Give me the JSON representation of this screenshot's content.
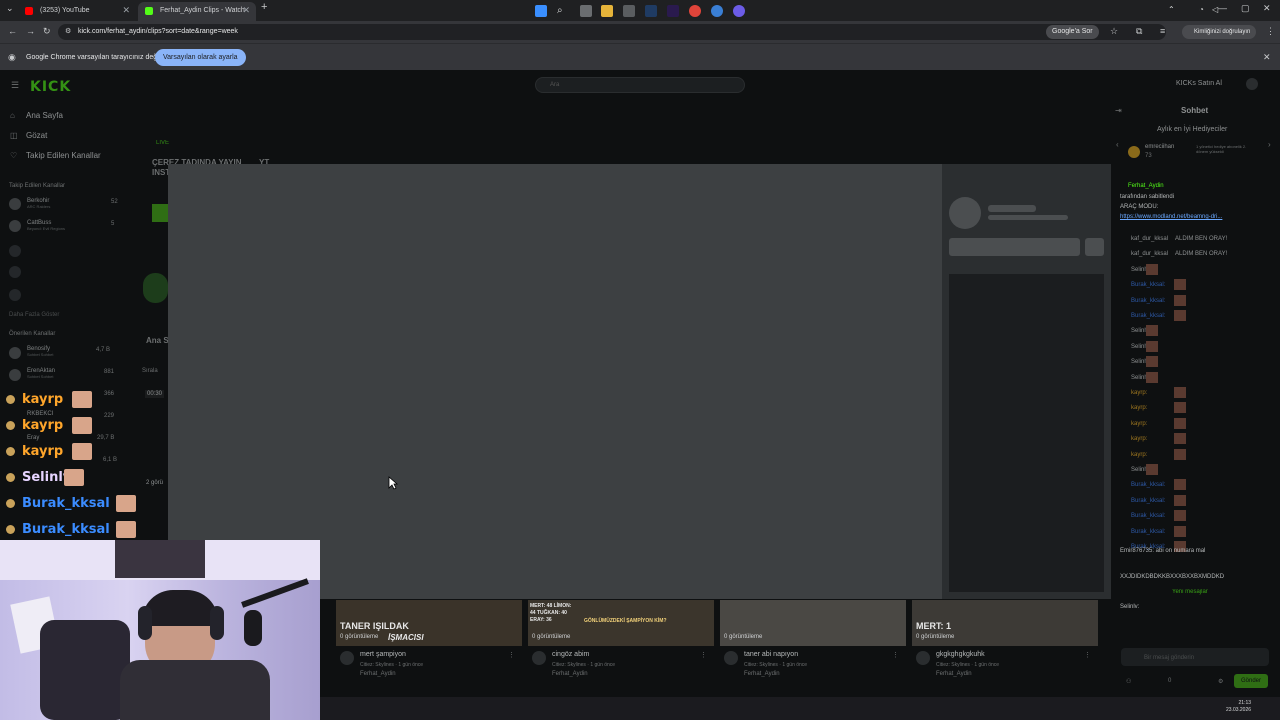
{
  "browser": {
    "tabs": [
      {
        "title": "(3253) YouTube",
        "favicon_color": "#ff0000"
      },
      {
        "title": "Ferhat_Aydin Clips - Watch",
        "favicon_color": "#53fc18"
      }
    ],
    "new_tab": "+",
    "url": "kick.com/ferhat_aydin/clips?sort=date&range=week",
    "google_sor": "Google'a Sor",
    "kimlik": "Kimliğinizi doğrulayın"
  },
  "infobar": {
    "text": "Google Chrome varsayılan tarayıcınız değil",
    "button": "Varsayılan olarak ayarla"
  },
  "kick": {
    "logo": "KICK",
    "search_placeholder": "Ara",
    "kicks_button": "KICKs Satın Al",
    "nav": [
      "Ana Sayfa",
      "Gözat",
      "Takip Edilen Kanallar"
    ],
    "followed_header": "Takip Edilen Kanallar",
    "followed": [
      {
        "name": "Berkohir",
        "sub": "ARC Raiders",
        "count": "52"
      },
      {
        "name": "CattBuss",
        "sub": "Beyond: Evil Regions",
        "count": "5"
      }
    ],
    "show_more": "Daha Fazla Göster",
    "recommended_header": "Önerilen Kanallar",
    "recommended": [
      {
        "name": "Benosify",
        "sub": "Sohbet Sohbet",
        "count": "4,7 B"
      },
      {
        "name": "ErenAktan",
        "sub": "Sohbet Sohbet",
        "count": "881"
      },
      {
        "name": "",
        "sub": "",
        "count": "366"
      },
      {
        "name": "RKBEKCI",
        "sub": "",
        "count": "229"
      },
      {
        "name": "Eray",
        "sub": "",
        "count": "29,7 B"
      },
      {
        "name": "",
        "sub": "",
        "count": "6,1 B"
      }
    ],
    "live_badge": "LIVE",
    "banner_title": "ÇEREZ TADINDA YAYIN",
    "banner_title2": "INST",
    "banner_yt": "YT",
    "home_label": "Ana S",
    "sort_label": "Sırala",
    "time_badge": "00:30",
    "views_left": "2 görü"
  },
  "overlay_chat": [
    {
      "name": "kayrp",
      "color": "#ffa62b"
    },
    {
      "name": "kayrp",
      "color": "#ffa62b"
    },
    {
      "name": "kayrp",
      "color": "#ffa62b"
    },
    {
      "name": "Selinlv",
      "color": "#e6d4ff"
    },
    {
      "name": "Burak_kksal",
      "color": "#3b8cff"
    },
    {
      "name": "Burak_kksal",
      "color": "#3b8cff"
    }
  ],
  "chat": {
    "header": "Sohbet",
    "gifts": "Aylık en İyi Hediyeciler",
    "gifter": "emreciihan",
    "gifter_count": "73",
    "gift_note": "1 yönetici hediye abonelik 2. dönem yükseldi",
    "pinned_user": "Ferhat_Aydin",
    "pinned_lines": [
      "tarafından sabitlendi",
      "ARAÇ MODU:",
      "https://www.modland.net/beamng-dri..."
    ],
    "messages": [
      {
        "user": "kaf_dur_kksal",
        "text": "ALDIM BEN ORAY!"
      },
      {
        "user": "kaf_dur_kksal",
        "text": "ALDIM BEN ORAY!"
      },
      {
        "user": "Selinlv:",
        "text": ""
      },
      {
        "user": "Burak_kksal:",
        "text": ""
      },
      {
        "user": "Burak_kksal:",
        "text": ""
      },
      {
        "user": "Burak_kksal:",
        "text": ""
      },
      {
        "user": "Selinlv:",
        "text": ""
      },
      {
        "user": "Selinlv:",
        "text": ""
      },
      {
        "user": "Selinlv:",
        "text": ""
      },
      {
        "user": "Selinlv:",
        "text": ""
      },
      {
        "user": "kayrp:",
        "text": ""
      },
      {
        "user": "kayrp:",
        "text": ""
      },
      {
        "user": "kayrp:",
        "text": ""
      },
      {
        "user": "kayrp:",
        "text": ""
      },
      {
        "user": "kayrp:",
        "text": ""
      },
      {
        "user": "Selinlv:",
        "text": ""
      },
      {
        "user": "Burak_kksal:",
        "text": ""
      },
      {
        "user": "Burak_kksal:",
        "text": ""
      },
      {
        "user": "Burak_kksal:",
        "text": ""
      },
      {
        "user": "Burak_kksal:",
        "text": ""
      },
      {
        "user": "Burak_kksal:",
        "text": ""
      }
    ],
    "mention": "Emir876735: abi on numara mal",
    "spam": "XXJDIDKDBDKKBXXXBXXBXMDDKD",
    "new_messages": "Yeni mesajlar",
    "last_user": "Selinlv:",
    "input_placeholder": "Bir mesaj gönderin",
    "viewers": "0",
    "kicks_count": "0",
    "send": "Gönder"
  },
  "clips": [
    {
      "title": "mert şampiyon",
      "channel": "Ferhat_Aydin",
      "meta": "Citiez: Skylines · 1 gün önce",
      "views": "0 görüntüleme",
      "overlay": "TANER IŞILDAK",
      "overlay2": "İŞMACISI"
    },
    {
      "title": "cingöz abim",
      "channel": "Ferhat_Aydin",
      "meta": "Citiez: Skylines · 1 gün önce",
      "views": "0 görüntüleme",
      "overlay": "GÖNLÜMÜZDEKİ ŞAMPİYON KİM?",
      "overlay2": "MERT: 48 LİMON: 44 TUĞKAN: 40 ERAY: 36"
    },
    {
      "title": "taner abi napıyon",
      "channel": "Ferhat_Aydin",
      "meta": "Citiez: Skylines · 1 gün önce",
      "views": "0 görüntüleme",
      "overlay": "",
      "overlay2": ""
    },
    {
      "title": "gkgkghgkgkuhk",
      "channel": "Ferhat_Aydin",
      "meta": "Citiez: Skylines · 1 gün önce",
      "views": "0 görüntüleme",
      "overlay": "MERT: 1",
      "overlay2": ""
    }
  ],
  "taskbar": {
    "time": "21:13",
    "date": "23.03.2026"
  }
}
